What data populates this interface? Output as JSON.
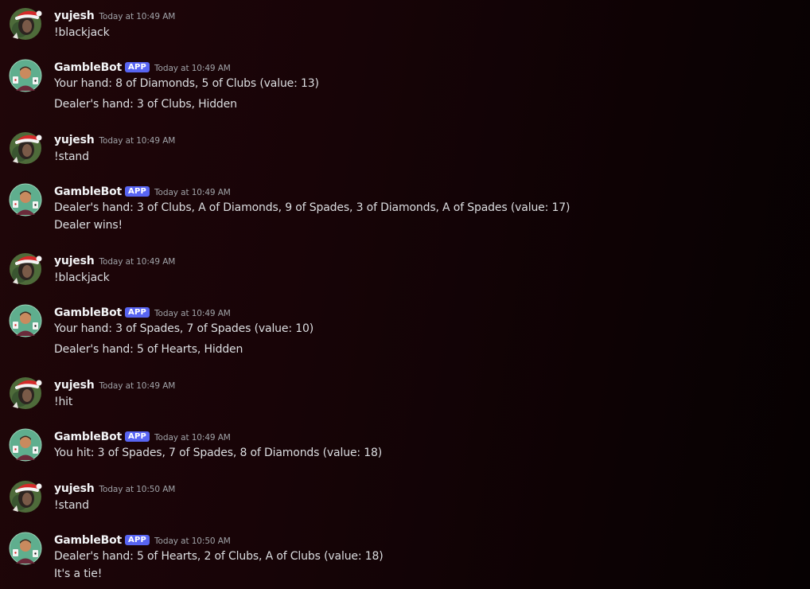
{
  "messages": [
    {
      "author": "yujesh",
      "is_app": false,
      "time": "Today at 10:49 AM",
      "lines": [
        "!blackjack"
      ]
    },
    {
      "author": "GambleBot",
      "is_app": true,
      "badge": "APP",
      "time": "Today at 10:49 AM",
      "lines": [
        "Your hand: 8 of Diamonds, 5 of Clubs (value: 13)",
        "Dealer's hand: 3 of Clubs, Hidden"
      ]
    },
    {
      "author": "yujesh",
      "is_app": false,
      "time": "Today at 10:49 AM",
      "lines": [
        "!stand"
      ]
    },
    {
      "author": "GambleBot",
      "is_app": true,
      "badge": "APP",
      "time": "Today at 10:49 AM",
      "lines": [
        "Dealer's hand: 3 of Clubs, A of Diamonds, 9 of Spades, 3 of Diamonds, A of Spades (value: 17)",
        "Dealer wins!"
      ]
    },
    {
      "author": "yujesh",
      "is_app": false,
      "time": "Today at 10:49 AM",
      "lines": [
        "!blackjack"
      ]
    },
    {
      "author": "GambleBot",
      "is_app": true,
      "badge": "APP",
      "time": "Today at 10:49 AM",
      "lines": [
        "Your hand: 3 of Spades, 7 of Spades (value: 10)",
        "Dealer's hand: 5 of Hearts, Hidden"
      ]
    },
    {
      "author": "yujesh",
      "is_app": false,
      "time": "Today at 10:49 AM",
      "lines": [
        "!hit"
      ]
    },
    {
      "author": "GambleBot",
      "is_app": true,
      "badge": "APP",
      "time": "Today at 10:49 AM",
      "lines": [
        "You hit: 3 of Spades, 7 of Spades, 8 of Diamonds (value: 18)"
      ]
    },
    {
      "author": "yujesh",
      "is_app": false,
      "time": "Today at 10:50 AM",
      "lines": [
        "!stand"
      ]
    },
    {
      "author": "GambleBot",
      "is_app": true,
      "badge": "APP",
      "time": "Today at 10:50 AM",
      "lines": [
        "Dealer's hand: 5 of Hearts, 2 of Clubs, A of Clubs (value: 18)",
        "It's a tie!"
      ]
    }
  ],
  "colors": {
    "background": "#1a0508",
    "app_badge": "#5865f2",
    "username": "#f2f3f5",
    "text": "#dcdee1",
    "timestamp": "#a0a3a8"
  },
  "icons": {
    "user_avatar": "avatar-santa-hat-icon",
    "bot_avatar": "avatar-gamblebot-icon"
  }
}
